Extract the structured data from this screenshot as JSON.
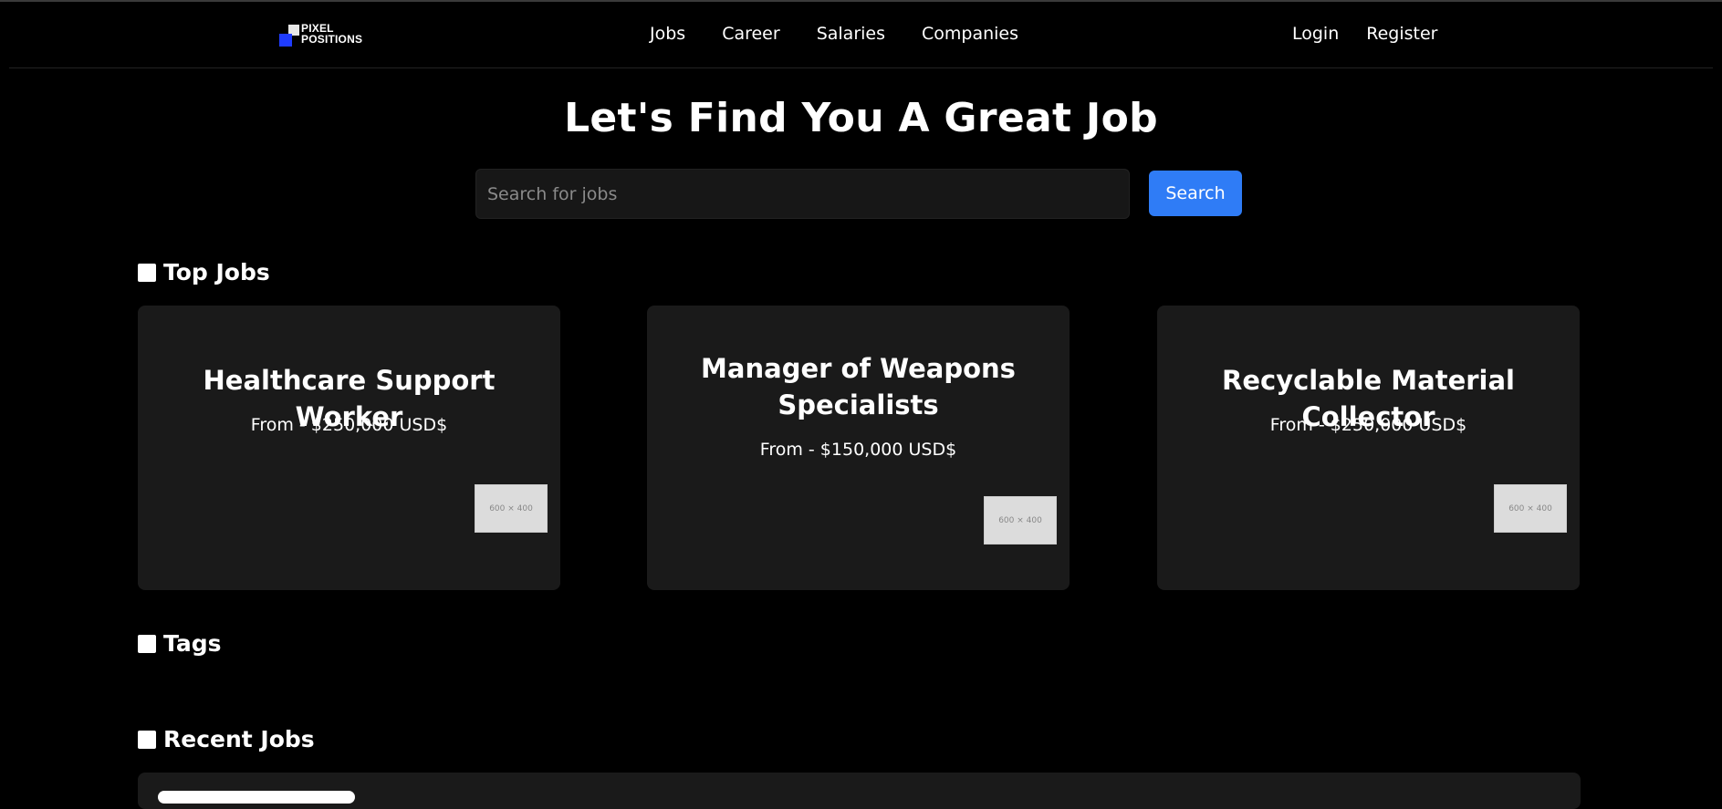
{
  "brand": {
    "logo_line1": "PIXEL",
    "logo_line2": "POSITIONS"
  },
  "nav": {
    "links": [
      "Jobs",
      "Career",
      "Salaries",
      "Companies"
    ],
    "auth": [
      "Login",
      "Register"
    ]
  },
  "hero": {
    "title": "Let's Find You A Great Job"
  },
  "search": {
    "placeholder": "Search for jobs",
    "button_label": "Search"
  },
  "sections": {
    "top_jobs": "Top Jobs",
    "tags": "Tags",
    "recent_jobs": "Recent Jobs"
  },
  "top_jobs": [
    {
      "title": "Healthcare Support Worker",
      "salary": "From - $250,000 USD$",
      "thumb_label": "600 × 400"
    },
    {
      "title": "Manager of Weapons Specialists",
      "salary": "From - $150,000 USD$",
      "thumb_label": "600 × 400"
    },
    {
      "title": "Recyclable Material Collector",
      "salary": "From - $250,000 USD$",
      "thumb_label": "600 × 400"
    }
  ],
  "colors": {
    "background": "#000000",
    "card": "#1a1a1a",
    "accent": "#2f7cf6",
    "logo_blue": "#1f3cff"
  }
}
